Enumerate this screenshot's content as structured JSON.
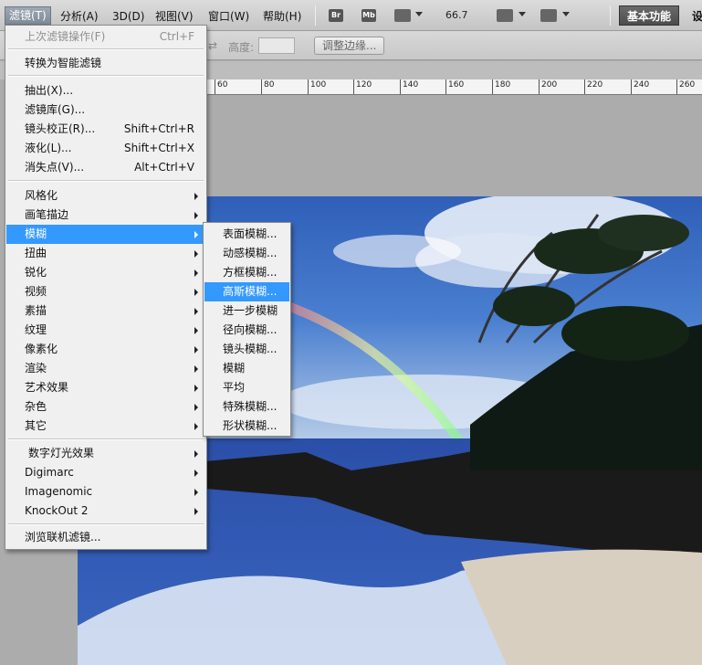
{
  "menubar": {
    "items": [
      {
        "label": "滤镜(T)"
      },
      {
        "label": "分析(A)"
      },
      {
        "label": "3D(D)"
      },
      {
        "label": "视图(V)"
      },
      {
        "label": "窗口(W)"
      },
      {
        "label": "帮助(H)"
      }
    ],
    "bridge_icon": "Br",
    "minibridge_icon": "Mb",
    "zoom": "66.7",
    "workspace": "基本功能",
    "settings_fragment": "设"
  },
  "options": {
    "height_label": "高度:",
    "refine_edge": "调整边缘..."
  },
  "ruler": {
    "labels": [
      "60",
      "80",
      "100",
      "120",
      "140",
      "160",
      "180",
      "200",
      "220",
      "240",
      "260"
    ]
  },
  "filter_menu": {
    "items": [
      {
        "label": "上次滤镜操作(F)",
        "shortcut": "Ctrl+F",
        "disabled": true
      },
      {
        "label": "转换为智能滤镜"
      },
      {
        "label": "抽出(X)..."
      },
      {
        "label": "滤镜库(G)..."
      },
      {
        "label": "镜头校正(R)...",
        "shortcut": "Shift+Ctrl+R"
      },
      {
        "label": "液化(L)...",
        "shortcut": "Shift+Ctrl+X"
      },
      {
        "label": "消失点(V)...",
        "shortcut": "Alt+Ctrl+V"
      },
      {
        "label": "风格化"
      },
      {
        "label": "画笔描边"
      },
      {
        "label": "模糊"
      },
      {
        "label": "扭曲"
      },
      {
        "label": "锐化"
      },
      {
        "label": "视频"
      },
      {
        "label": "素描"
      },
      {
        "label": "纹理"
      },
      {
        "label": "像素化"
      },
      {
        "label": "渲染"
      },
      {
        "label": "艺术效果"
      },
      {
        "label": "杂色"
      },
      {
        "label": "其它"
      },
      {
        "label": "数字灯光效果"
      },
      {
        "label": "Digimarc"
      },
      {
        "label": "Imagenomic"
      },
      {
        "label": "KnockOut 2"
      },
      {
        "label": "浏览联机滤镜..."
      }
    ]
  },
  "blur_menu": {
    "items": [
      {
        "label": "表面模糊..."
      },
      {
        "label": "动感模糊..."
      },
      {
        "label": "方框模糊..."
      },
      {
        "label": "高斯模糊..."
      },
      {
        "label": "进一步模糊"
      },
      {
        "label": "径向模糊..."
      },
      {
        "label": "镜头模糊..."
      },
      {
        "label": "模糊"
      },
      {
        "label": "平均"
      },
      {
        "label": "特殊模糊..."
      },
      {
        "label": "形状模糊..."
      }
    ]
  },
  "colors": {
    "highlight": "#3399ff",
    "menu_bg": "#f0f0f0",
    "workspace_bg": "#acacac"
  }
}
